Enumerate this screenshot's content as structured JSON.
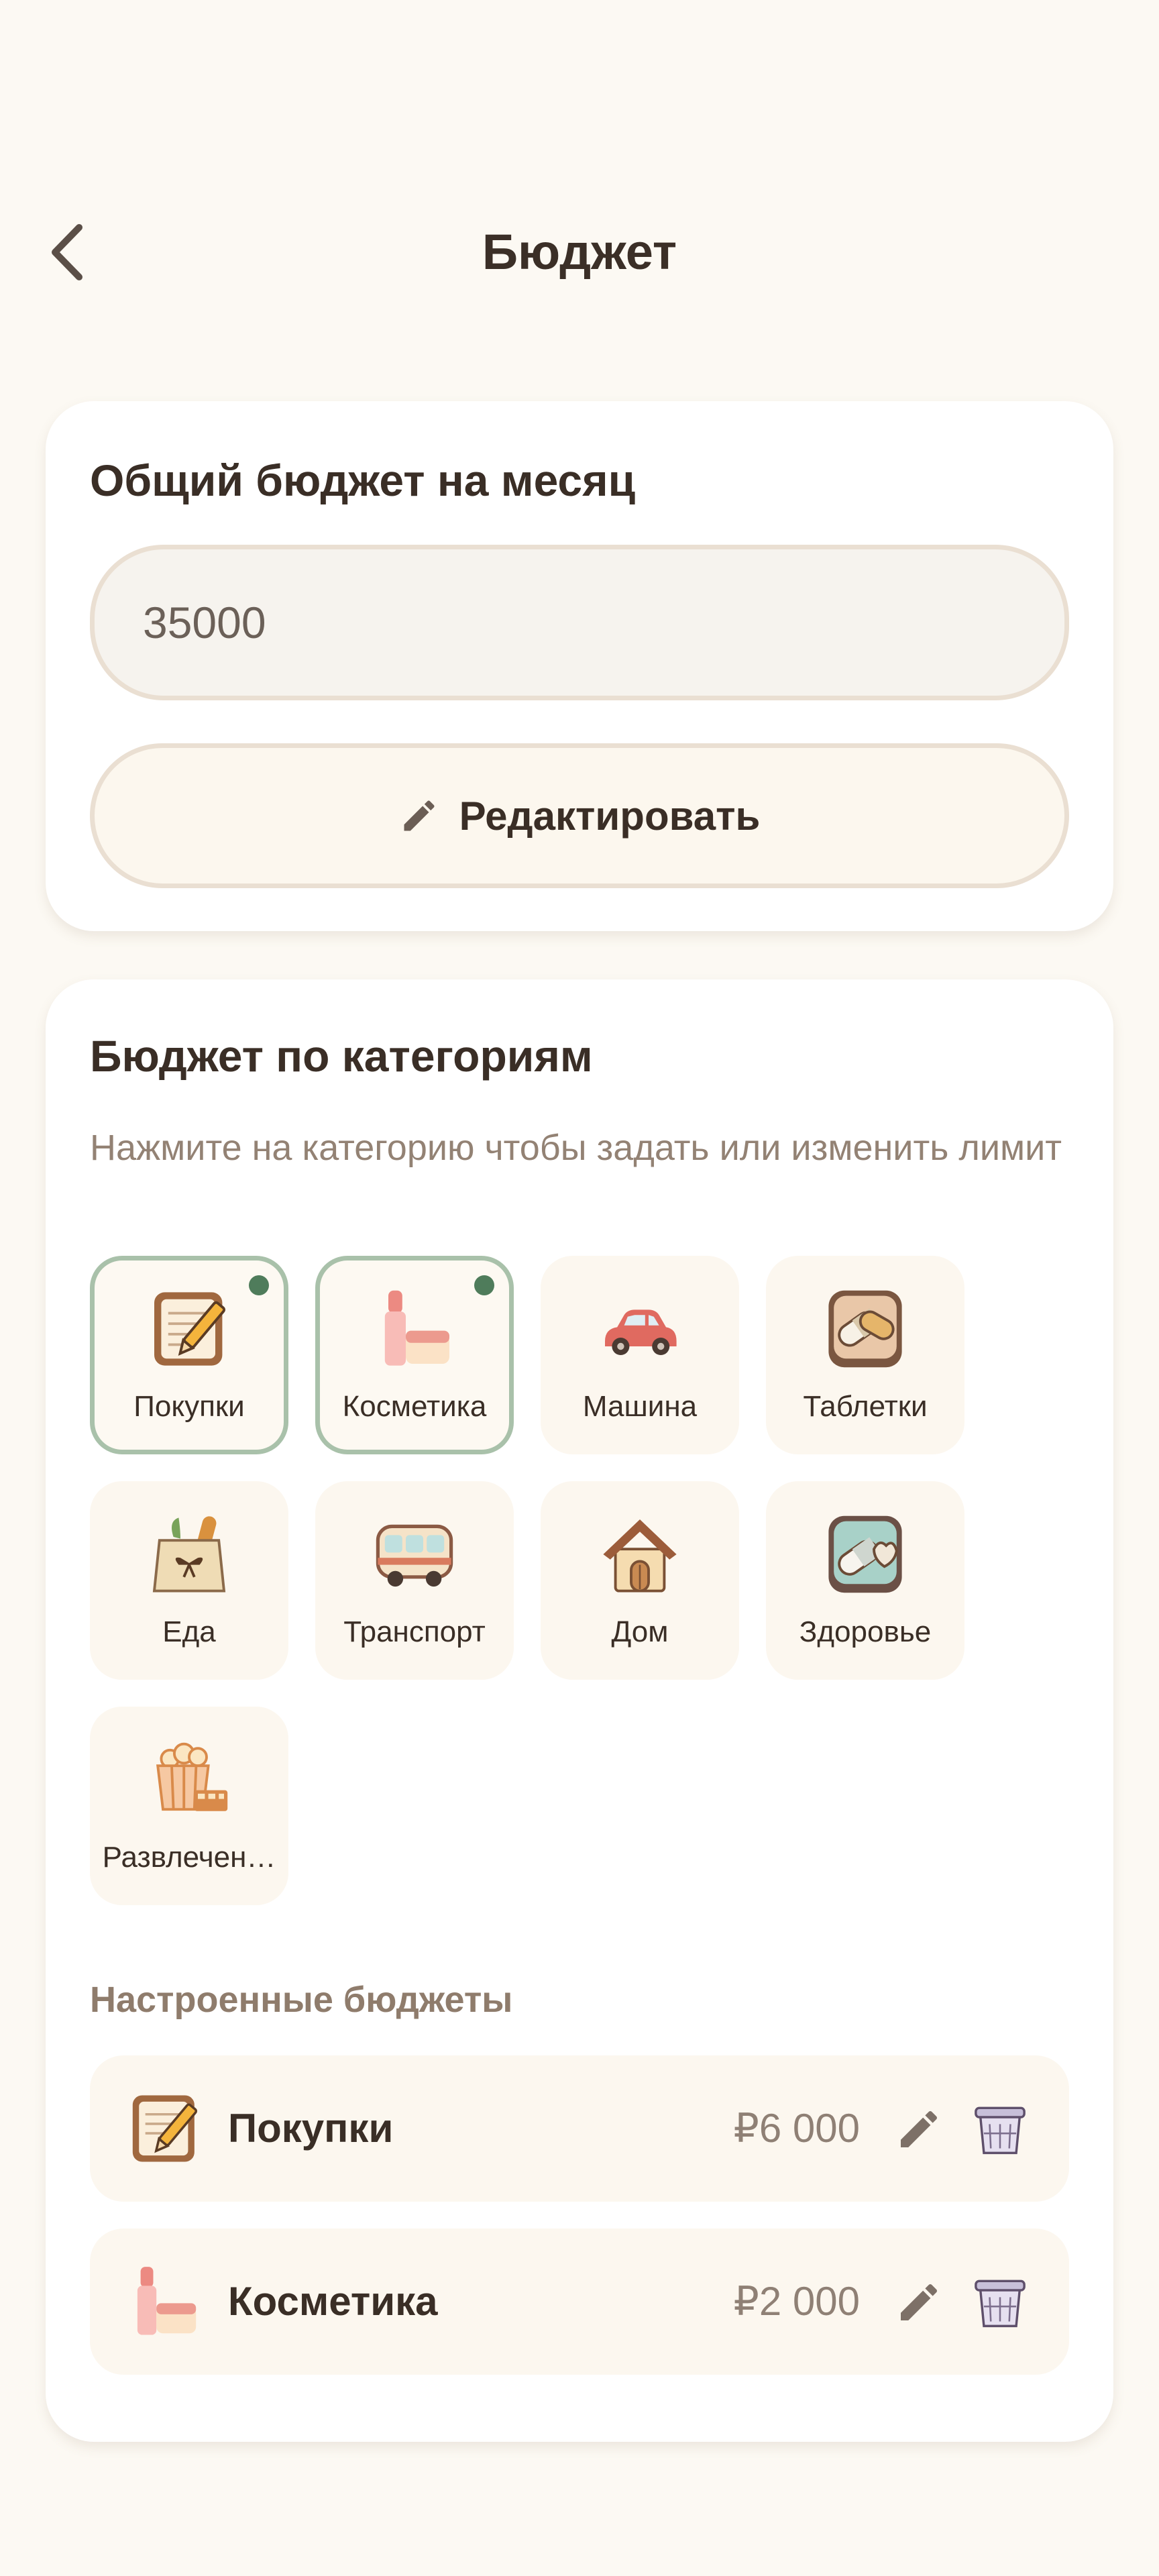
{
  "header": {
    "title": "Бюджет",
    "back_icon": "chevron-left-icon"
  },
  "monthly_budget": {
    "title": "Общий бюджет на месяц",
    "value": "35000",
    "edit_button_label": "Редактировать",
    "edit_icon": "pencil-icon"
  },
  "categories": {
    "title": "Бюджет по категориям",
    "hint": "Нажмите на категорию чтобы задать или изменить лимит",
    "items": [
      {
        "label": "Покупки",
        "icon": "notepad-pencil-icon",
        "has_budget": true
      },
      {
        "label": "Косметика",
        "icon": "lipstick-cream-icon",
        "has_budget": true
      },
      {
        "label": "Машина",
        "icon": "car-icon",
        "has_budget": false
      },
      {
        "label": "Таблетки",
        "icon": "pills-icon",
        "has_budget": false
      },
      {
        "label": "Еда",
        "icon": "grocery-bag-icon",
        "has_budget": false
      },
      {
        "label": "Транспорт",
        "icon": "bus-icon",
        "has_budget": false
      },
      {
        "label": "Дом",
        "icon": "house-icon",
        "has_budget": false
      },
      {
        "label": "Здоровье",
        "icon": "health-pills-icon",
        "has_budget": false
      },
      {
        "label": "Развлечен…",
        "icon": "popcorn-film-icon",
        "has_budget": false
      }
    ]
  },
  "configured_budgets": {
    "title": "Настроенные бюджеты",
    "items": [
      {
        "name": "Покупки",
        "amount": "₽6 000",
        "icon": "notepad-pencil-icon"
      },
      {
        "name": "Косметика",
        "amount": "₽2 000",
        "icon": "lipstick-cream-icon"
      }
    ],
    "edit_icon": "pencil-icon",
    "delete_icon": "trash-basket-icon"
  },
  "colors": {
    "background": "#fcf9f3",
    "card": "#ffffff",
    "selected_border": "#a9c1aa",
    "selected_dot": "#4f7c5b",
    "muted_text": "#938274"
  }
}
